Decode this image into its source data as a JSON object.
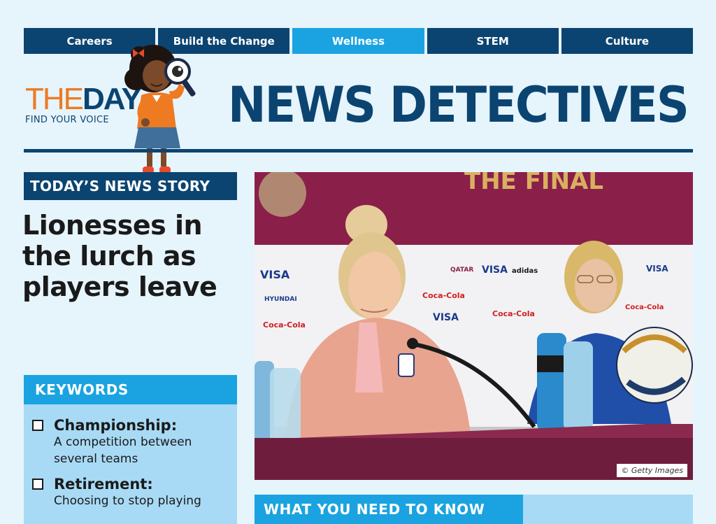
{
  "nav": {
    "tabs": [
      {
        "label": "Careers"
      },
      {
        "label": "Build the Change"
      },
      {
        "label": "Wellness"
      },
      {
        "label": "STEM"
      },
      {
        "label": "Culture"
      }
    ],
    "active": "Wellness"
  },
  "brand": {
    "logo_the": "THE",
    "logo_day": "DAY",
    "tagline": "FIND YOUR VOICE"
  },
  "masthead": "NEWS DETECTIVES",
  "story": {
    "label": "TODAY’S NEWS STORY",
    "headline": "Lionesses in the lurch as players leave"
  },
  "keywords": {
    "heading": "KEYWORDS",
    "items": [
      {
        "term": "Championship:",
        "definition": "A competition between several teams"
      },
      {
        "term": "Retirement:",
        "definition": "Choosing to stop playing"
      }
    ]
  },
  "photo": {
    "credit": "© Getty Images",
    "backdrop_text": "THE FINAL",
    "sponsors": [
      "VISA",
      "HYUNDAI",
      "Coca-Cola",
      "QATAR",
      "adidas"
    ]
  },
  "what_you_need": {
    "heading": "WHAT YOU NEED TO KNOW"
  },
  "colors": {
    "navy": "#0b4470",
    "sky": "#1aa3e0",
    "panel": "#a8daf5",
    "page": "#e6f4fc",
    "orange": "#ee7a22"
  }
}
